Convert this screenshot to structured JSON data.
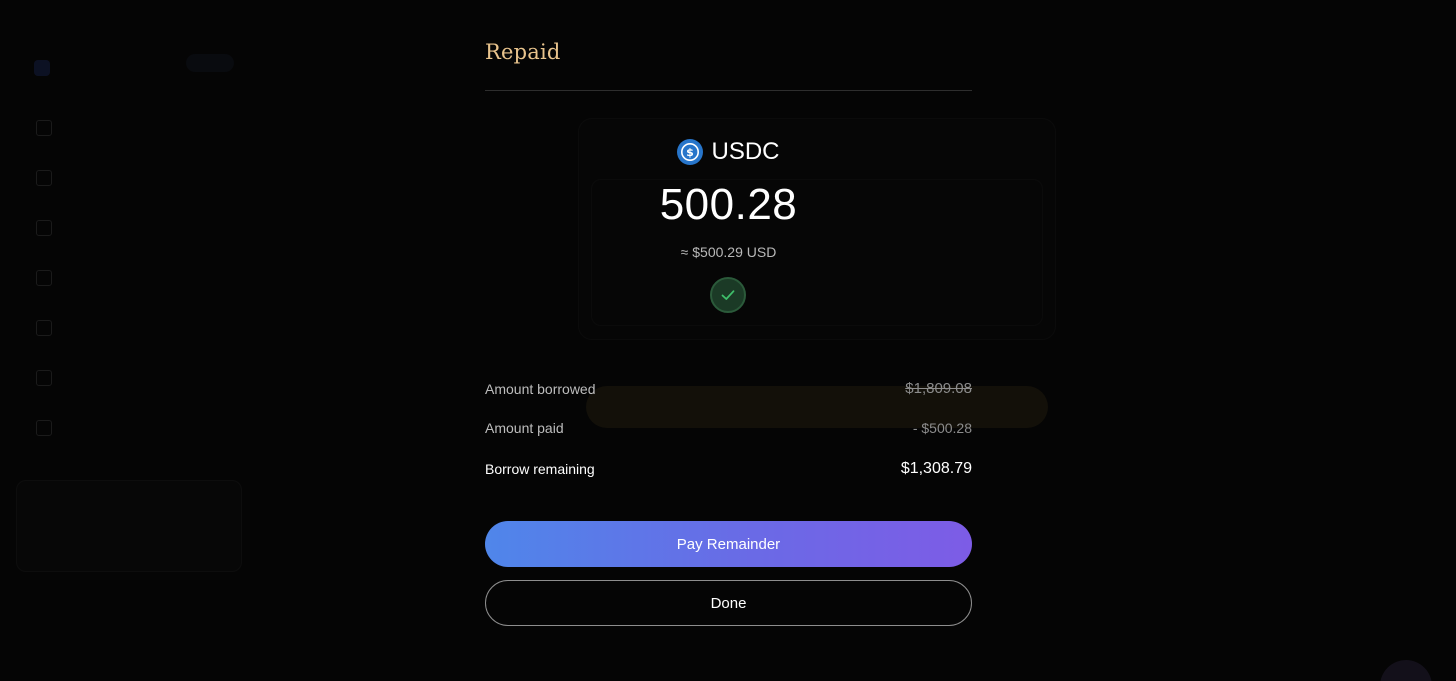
{
  "background": {
    "logo": "",
    "network_chip": "",
    "main_title": "",
    "card_value": "",
    "warning": "",
    "nav_items": [
      {
        "label": ""
      },
      {
        "label": ""
      },
      {
        "label": ""
      },
      {
        "label": ""
      },
      {
        "label": ""
      },
      {
        "label": ""
      },
      {
        "label": ""
      }
    ],
    "promo": {
      "title": "",
      "subtitle": ""
    },
    "bottom_link": ""
  },
  "modal": {
    "title": "Repaid",
    "asset": {
      "icon": "usdc-icon",
      "name": "USDC"
    },
    "amount": "500.28",
    "usd_value": "≈ $500.29 USD",
    "status_icon": "check-icon",
    "summary": {
      "borrowed_label": "Amount borrowed",
      "borrowed_value": "$1,809.08",
      "paid_label": "Amount paid",
      "paid_value": "- $500.28",
      "remaining_label": "Borrow remaining",
      "remaining_value": "$1,308.79"
    },
    "primary_button": "Pay Remainder",
    "secondary_button": "Done"
  },
  "colors": {
    "title_gold": "#e9c48d",
    "usdc_blue": "#2775ca",
    "success_green": "#3fbf6a",
    "gradient_start": "#4f86ea",
    "gradient_end": "#7d5ce6"
  }
}
